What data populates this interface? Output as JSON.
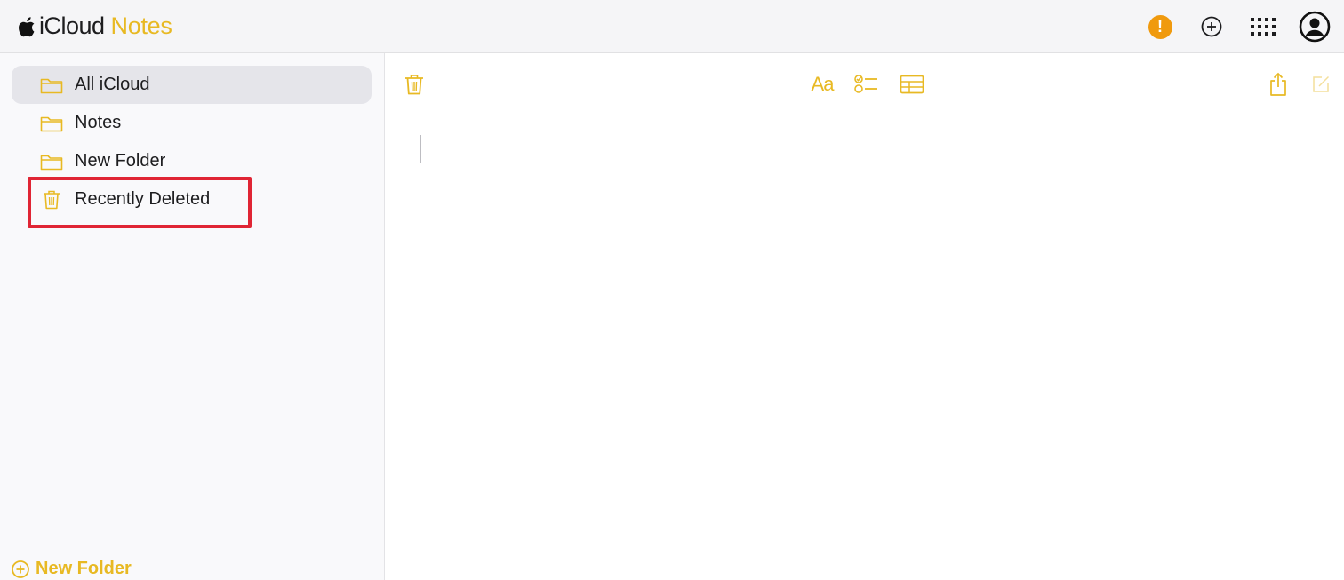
{
  "header": {
    "brand_icloud": "iCloud",
    "brand_notes": "Notes",
    "icons": [
      "apple-icon",
      "alert-icon",
      "add-circle-icon",
      "app-grid-icon",
      "account-icon"
    ],
    "alert_symbol": "!"
  },
  "sidebar": {
    "items": [
      {
        "label": "All iCloud",
        "icon": "folder-icon",
        "selected": true
      },
      {
        "label": "Notes",
        "icon": "folder-icon",
        "selected": false
      },
      {
        "label": "New Folder",
        "icon": "folder-icon",
        "selected": false
      },
      {
        "label": "Recently Deleted",
        "icon": "trash-icon",
        "selected": false,
        "highlighted": true
      }
    ],
    "new_folder_label": "New Folder"
  },
  "toolbar": {
    "format_label": "Aa",
    "icons": [
      "trash-icon",
      "format-text-icon",
      "checklist-icon",
      "table-icon",
      "share-icon",
      "compose-icon"
    ]
  },
  "colors": {
    "accent": "#e8b923",
    "alert": "#f09a0e",
    "highlight_border": "#e02534",
    "selected_bg": "#e5e5ea"
  }
}
